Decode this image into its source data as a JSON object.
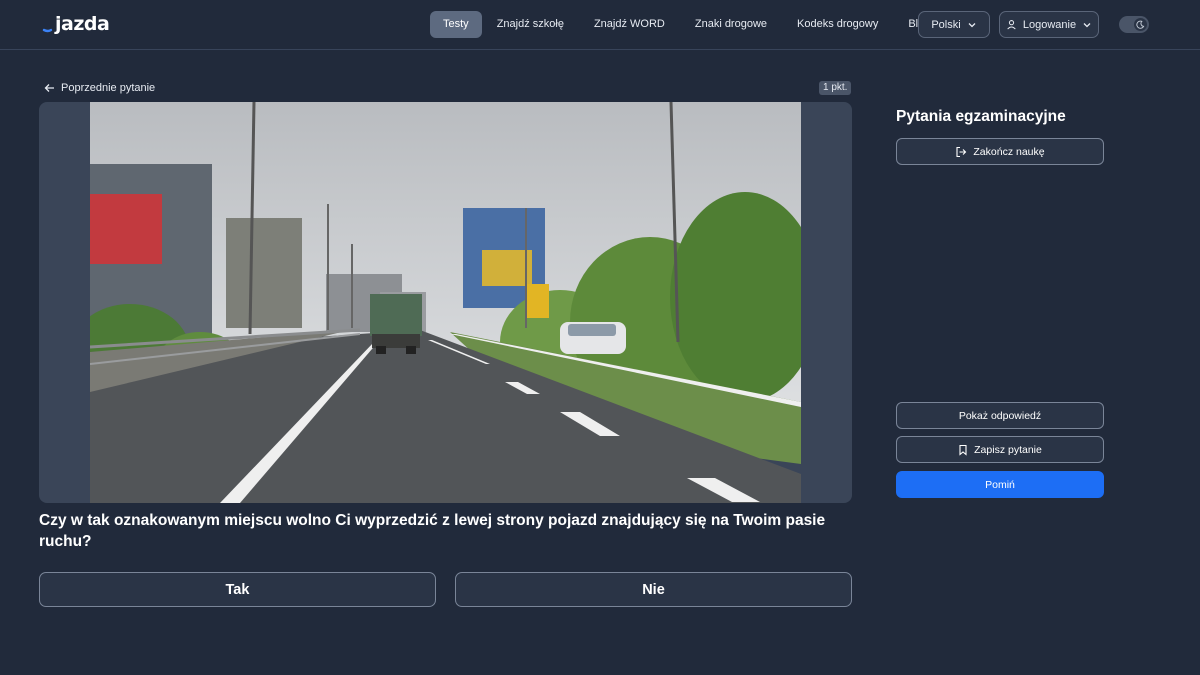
{
  "header": {
    "logo_text": "jazda",
    "nav": [
      {
        "label": "Testy",
        "active": true
      },
      {
        "label": "Znajdź szkołę",
        "active": false
      },
      {
        "label": "Znajdź WORD",
        "active": false
      },
      {
        "label": "Znaki drogowe",
        "active": false
      },
      {
        "label": "Kodeks drogowy",
        "active": false
      },
      {
        "label": "Blog",
        "active": false
      }
    ],
    "language": "Polski",
    "login": "Logowanie",
    "theme_toggle_icon": "moon-icon"
  },
  "question_panel": {
    "back_label": "Poprzednie pytanie",
    "points": "1 pkt.",
    "question_text": "Czy w tak oznakowanym miejscu wolno Ci wyprzedzić z lewej strony pojazd znajdujący się na Twoim pasie ruchu?",
    "answers": [
      "Tak",
      "Nie"
    ]
  },
  "sidebar": {
    "title": "Pytania egzaminacyjne",
    "finish_label": "Zakończ naukę",
    "show_answer_label": "Pokaż odpowiedź",
    "save_label": "Zapisz pytanie",
    "skip_label": "Pomiń"
  },
  "colors": {
    "background": "#212a3b",
    "accent": "#1d6ef5",
    "nav_active": "#5d6a80"
  }
}
